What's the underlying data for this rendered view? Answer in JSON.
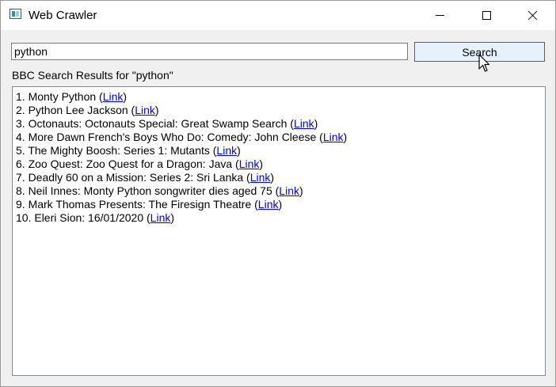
{
  "window": {
    "title": "Web Crawler",
    "controls": {
      "minimize": "minimize-icon",
      "maximize": "maximize-icon",
      "close": "close-icon"
    }
  },
  "search": {
    "value": "python",
    "button_label": "Search"
  },
  "results_label": "BBC Search Results for \"python\"",
  "results": [
    {
      "prefix": "1. Monty Python (",
      "link": "Link",
      "suffix": ")"
    },
    {
      "prefix": "2. Python Lee Jackson (",
      "link": "Link",
      "suffix": ")"
    },
    {
      "prefix": "3. Octonauts: Octonauts Special: Great Swamp Search (",
      "link": "Link",
      "suffix": ")"
    },
    {
      "prefix": "4. More Dawn French's Boys Who Do: Comedy: John Cleese (",
      "link": "Link",
      "suffix": ")"
    },
    {
      "prefix": "5. The Mighty Boosh: Series 1: Mutants (",
      "link": "Link",
      "suffix": ")"
    },
    {
      "prefix": "6. Zoo Quest: Zoo Quest for a Dragon: Java (",
      "link": "Link",
      "suffix": ")"
    },
    {
      "prefix": "7. Deadly 60 on a Mission: Series 2: Sri Lanka (",
      "link": "Link",
      "suffix": ")"
    },
    {
      "prefix": "8. Neil Innes: Monty Python songwriter dies aged 75 (",
      "link": "Link",
      "suffix": ")"
    },
    {
      "prefix": "9. Mark Thomas Presents: The Firesign Theatre (",
      "link": "Link",
      "suffix": ")"
    },
    {
      "prefix": "10. Eleri Sion: 16/01/2020 (",
      "link": "Link",
      "suffix": ")"
    }
  ],
  "colors": {
    "link": "#0000ee",
    "button_border": "#0078d7",
    "button_bg": "#e5f1fb"
  }
}
